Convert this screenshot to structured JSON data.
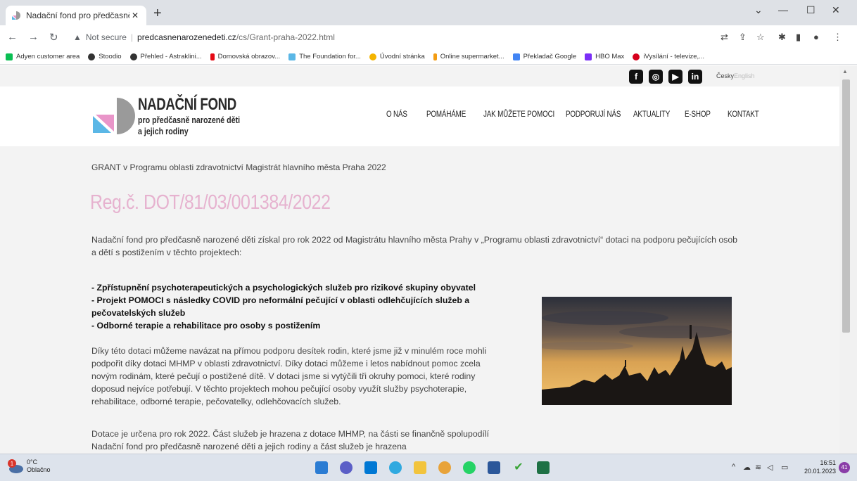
{
  "browser": {
    "tab_title": "Nadační fond pro předčasně nar",
    "url_security": "Not secure",
    "url_host": "predcasnenarozenedeti.cz",
    "url_path": "/cs/Grant-praha-2022.html",
    "bookmarks": [
      "Adyen customer area",
      "Stoodio",
      "Přehled - Astraklini...",
      "Domovská obrazov...",
      "The Foundation for...",
      "Úvodní stránka",
      "Online supermarket...",
      "Překladač Google",
      "HBO Max",
      "iVysílání - televize,..."
    ]
  },
  "site": {
    "lang_cz": "Česky",
    "lang_en": "English",
    "logo": {
      "title": "NADAČNÍ FOND",
      "line1": "pro předčasně narozené děti",
      "line2": "a jejich rodiny"
    },
    "nav": [
      "O NÁS",
      "POMÁHÁME",
      "JAK MŮŽETE POMOCI",
      "PODPORUJÍ NÁS",
      "AKTUALITY",
      "E-SHOP",
      "KONTAKT"
    ]
  },
  "content": {
    "breadcrumb": "GRANT v Programu oblasti zdravotnictví Magistrát hlavního města Praha 2022",
    "title": "Reg.č. DOT/81/03/001384/2022",
    "intro": "Nadační fond pro předčasně narozené děti získal pro rok 2022 od Magistrátu hlavního města Prahy v „Programu oblasti zdravotnictví“ dotaci na podporu pečujících osob a dětí s postižením v těchto projektech:",
    "bullets": [
      "- Zpřístupnění psychoterapeutických a psychologických služeb pro rizikové skupiny obyvatel",
      "- Projekt POMOCI s následky COVID pro neformální pečující v oblasti odlehčujících služeb a pečovatelských služeb",
      "- Odborné terapie a rehabilitace pro osoby s postižením"
    ],
    "para1": "Díky této dotaci můžeme navázat na přímou podporu desítek rodin, které jsme již v minulém roce mohli podpořit díky dotaci MHMP v oblasti zdravotnictví. Díky dotaci můžeme i letos nabídnout pomoc zcela novým rodinám, které pečují o postižené dítě. V dotaci jsme si vytýčili tři okruhy pomoci, které rodiny doposud nejvíce potřebují. V těchto projektech mohou pečující osoby využít služby psychoterapie, rehabilitace, odborné terapie, pečovatelky, odlehčovacích služeb.",
    "para2": "Dotace je určena pro rok 2022. Část služeb je hrazena z dotace MHMP, na části se finančně spolupodílí Nadační fond pro předčasně narozené děti a jejich rodiny a část služeb je hrazena"
  },
  "taskbar": {
    "weather_temp": "0°C",
    "weather_desc": "Oblačno",
    "weather_badge": "1",
    "time": "16:51",
    "date": "20.01.2023",
    "notifications": "41"
  },
  "colors": {
    "title_pink": "#e6b2cf",
    "logo_blue": "#5bb7e6",
    "logo_pink": "#e995c9",
    "logo_gray": "#9a9a9a"
  }
}
